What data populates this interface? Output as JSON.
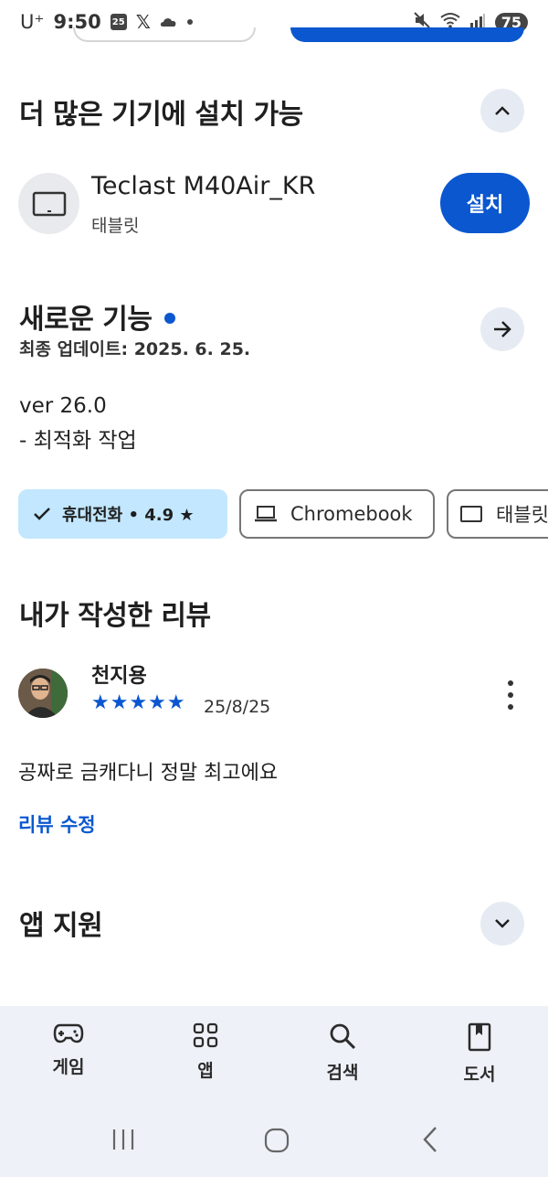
{
  "status_bar": {
    "carrier": "U⁺",
    "time": "9:50",
    "calendar_day": "25",
    "battery": "75",
    "icons": [
      "calendar-icon",
      "x-icon",
      "cloud-icon",
      "dot-icon",
      "mute-icon",
      "wifi-icon",
      "signal-icon",
      "battery-icon"
    ]
  },
  "install_more": {
    "title": "더 많은 기기에 설치 가능",
    "device": {
      "name": "Teclast M40Air_KR",
      "type": "태블릿",
      "install_label": "설치"
    }
  },
  "whats_new": {
    "title": "새로운 기능",
    "updated": "최종 업데이트: 2025. 6. 25.",
    "notes": [
      "ver 26.0",
      "- 최적화 작업"
    ]
  },
  "device_chips": [
    {
      "label": "휴대전화 • 4.9 ★",
      "selected": true,
      "icon": "check-icon"
    },
    {
      "label": "Chromebook",
      "selected": false,
      "icon": "laptop-icon"
    },
    {
      "label": "태블릿",
      "selected": false,
      "icon": "tablet-icon"
    }
  ],
  "my_review": {
    "title": "내가 작성한 리뷰",
    "reviewer": "천지용",
    "stars": "★★★★★",
    "rating": 5,
    "date": "25/8/25",
    "text": "공짜로 금캐다니 정말 최고에요",
    "edit_label": "리뷰 수정"
  },
  "app_support": {
    "title": "앱 지원"
  },
  "bottom_nav": [
    {
      "label": "게임",
      "icon": "gamepad-icon"
    },
    {
      "label": "앱",
      "icon": "apps-grid-icon"
    },
    {
      "label": "검색",
      "icon": "search-icon"
    },
    {
      "label": "도서",
      "icon": "book-icon"
    }
  ],
  "colors": {
    "accent": "#0b57d0",
    "chip_selected": "#c2e7ff",
    "circle_button": "#e6ebf3",
    "nav_bg": "#eef2f8"
  }
}
